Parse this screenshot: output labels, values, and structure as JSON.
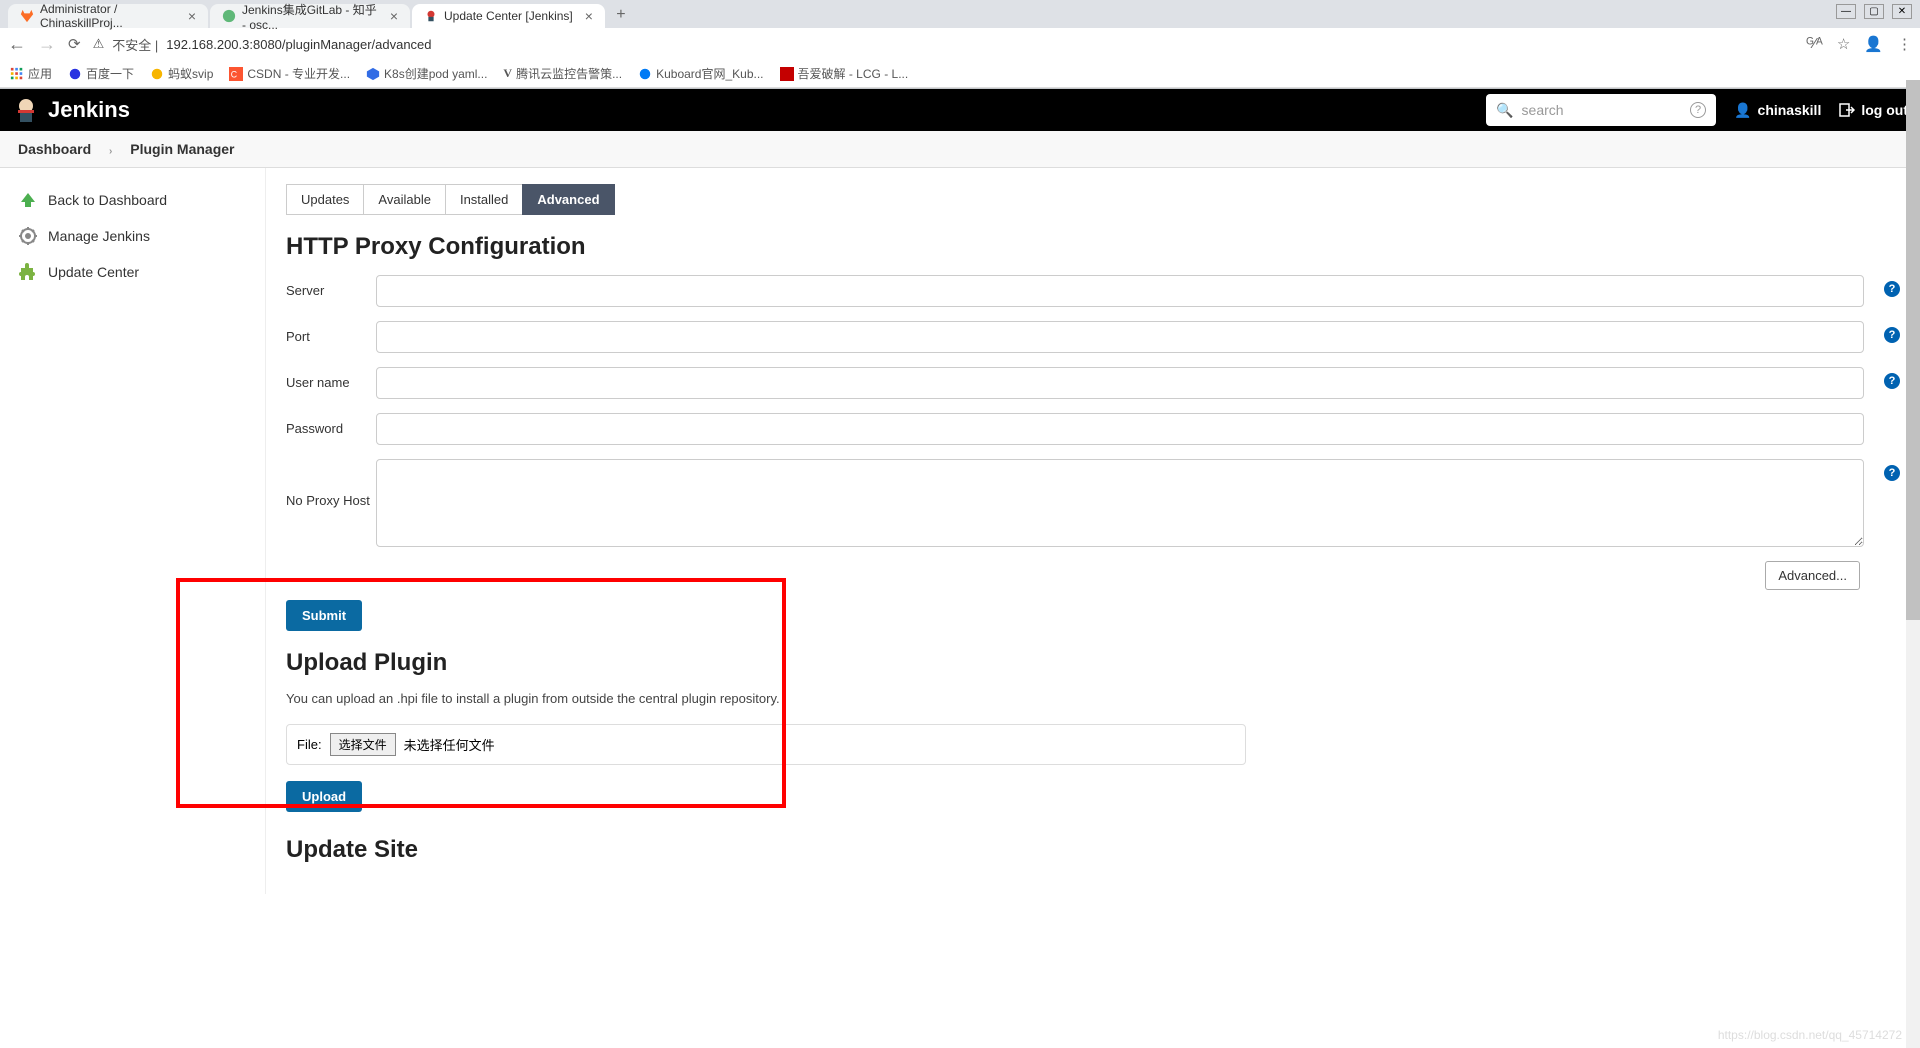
{
  "browser": {
    "tabs": [
      {
        "title": "Administrator / ChinaskillProj..."
      },
      {
        "title": "Jenkins集成GitLab - 知乎 - osc..."
      },
      {
        "title": "Update Center [Jenkins]"
      }
    ],
    "url_prefix": "不安全 |",
    "url": "192.168.200.3:8080/pluginManager/advanced",
    "bookmarks": [
      "应用",
      "百度一下",
      "蚂蚁svip",
      "CSDN - 专业开发...",
      "K8s创建pod yaml...",
      "腾讯云监控告警策...",
      "Kuboard官网_Kub...",
      "吾爱破解 - LCG - L..."
    ]
  },
  "header": {
    "brand": "Jenkins",
    "search_placeholder": "search",
    "user": "chinaskill",
    "logout": "log out"
  },
  "breadcrumb": {
    "items": [
      "Dashboard",
      "Plugin Manager"
    ]
  },
  "sidebar": {
    "items": [
      {
        "label": "Back to Dashboard"
      },
      {
        "label": "Manage Jenkins"
      },
      {
        "label": "Update Center"
      }
    ]
  },
  "pluginTabs": {
    "updates": "Updates",
    "available": "Available",
    "installed": "Installed",
    "advanced": "Advanced"
  },
  "proxy": {
    "heading": "HTTP Proxy Configuration",
    "server": "Server",
    "port": "Port",
    "username": "User name",
    "password": "Password",
    "noproxy": "No Proxy Host",
    "advanced_btn": "Advanced...",
    "submit_btn": "Submit"
  },
  "upload": {
    "heading": "Upload Plugin",
    "desc": "You can upload an .hpi file to install a plugin from outside the central plugin repository.",
    "file_label": "File:",
    "choose_btn": "选择文件",
    "no_file": "未选择任何文件",
    "upload_btn": "Upload"
  },
  "updateSite": {
    "heading": "Update Site"
  }
}
